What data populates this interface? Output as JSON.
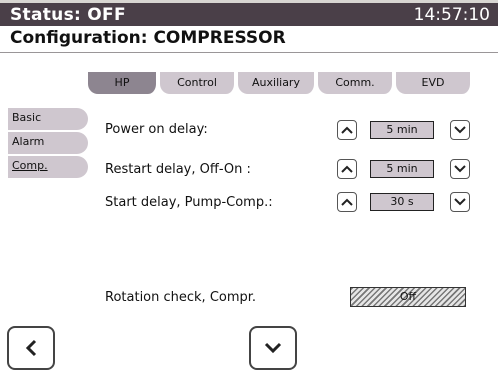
{
  "status": {
    "label": "Status: OFF",
    "time": "14:57:10"
  },
  "config": {
    "title": "Configuration: COMPRESSOR"
  },
  "tabs": [
    "HP",
    "Control",
    "Auxiliary",
    "Comm.",
    "EVD"
  ],
  "side_tabs": [
    "Basic",
    "Alarm",
    "Comp."
  ],
  "rows": [
    {
      "label": "Power on delay:",
      "value": "5 min"
    },
    {
      "label": "Restart delay, Off-On :",
      "value": "5 min"
    },
    {
      "label": "Start delay, Pump-Comp.:",
      "value": "30 s"
    }
  ],
  "rotation": {
    "label": "Rotation check, Compr.",
    "value": "Off"
  },
  "icons": {
    "up": "chevron-up-icon",
    "down": "chevron-down-icon",
    "back": "chevron-left-icon"
  }
}
